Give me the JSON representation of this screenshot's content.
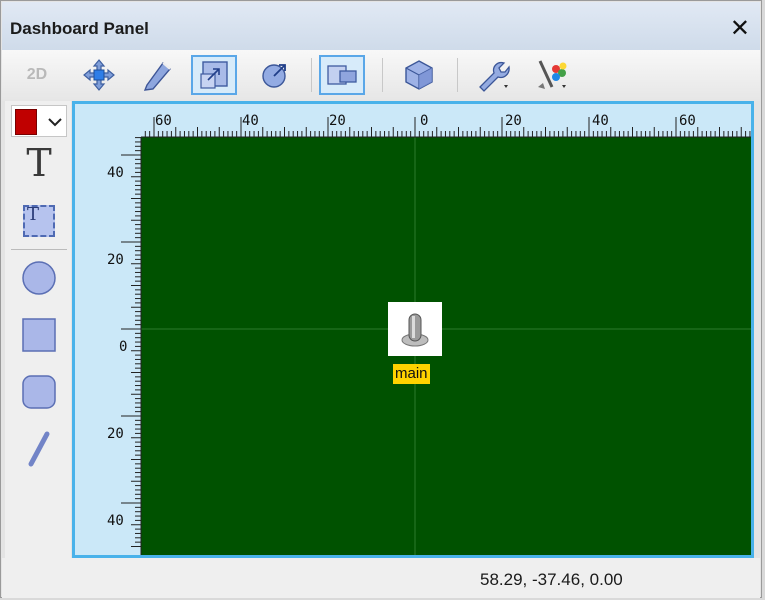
{
  "panel": {
    "title": "Dashboard Panel",
    "close_glyph": "✕"
  },
  "toolbar": {
    "mode_label": "2D",
    "tools": [
      "move-icon",
      "pencil-icon",
      "resize-icon",
      "rotate-icon",
      "frame-icon",
      "cube-icon",
      "wrench-icon",
      "palette-icon"
    ],
    "active_tools": [
      "resize-icon",
      "frame-icon"
    ]
  },
  "left_tools": {
    "text_glyph": "T",
    "text_box_glyph": "T",
    "color_swatch": "#c00000",
    "items": [
      "color-picker",
      "text-icon",
      "text-box-icon",
      "circle-icon",
      "rectangle-icon",
      "rounded-rectangle-icon",
      "line-icon"
    ]
  },
  "canvas": {
    "background": "#005200",
    "ruler_bg": "#cbe8f8",
    "top_ruler_labels": [
      "60",
      "40",
      "20",
      "0",
      "20",
      "40",
      "60"
    ],
    "left_ruler_labels": [
      "40",
      "20",
      "0",
      "20",
      "40"
    ],
    "object": {
      "icon": "joystick-icon",
      "label": "main",
      "label_color": "#ffd200"
    }
  },
  "status": {
    "coordinates": "58.29, -37.46, 0.00"
  },
  "colors": {
    "accent": "#49b2ea",
    "shape_fill": "#aab7e8"
  }
}
